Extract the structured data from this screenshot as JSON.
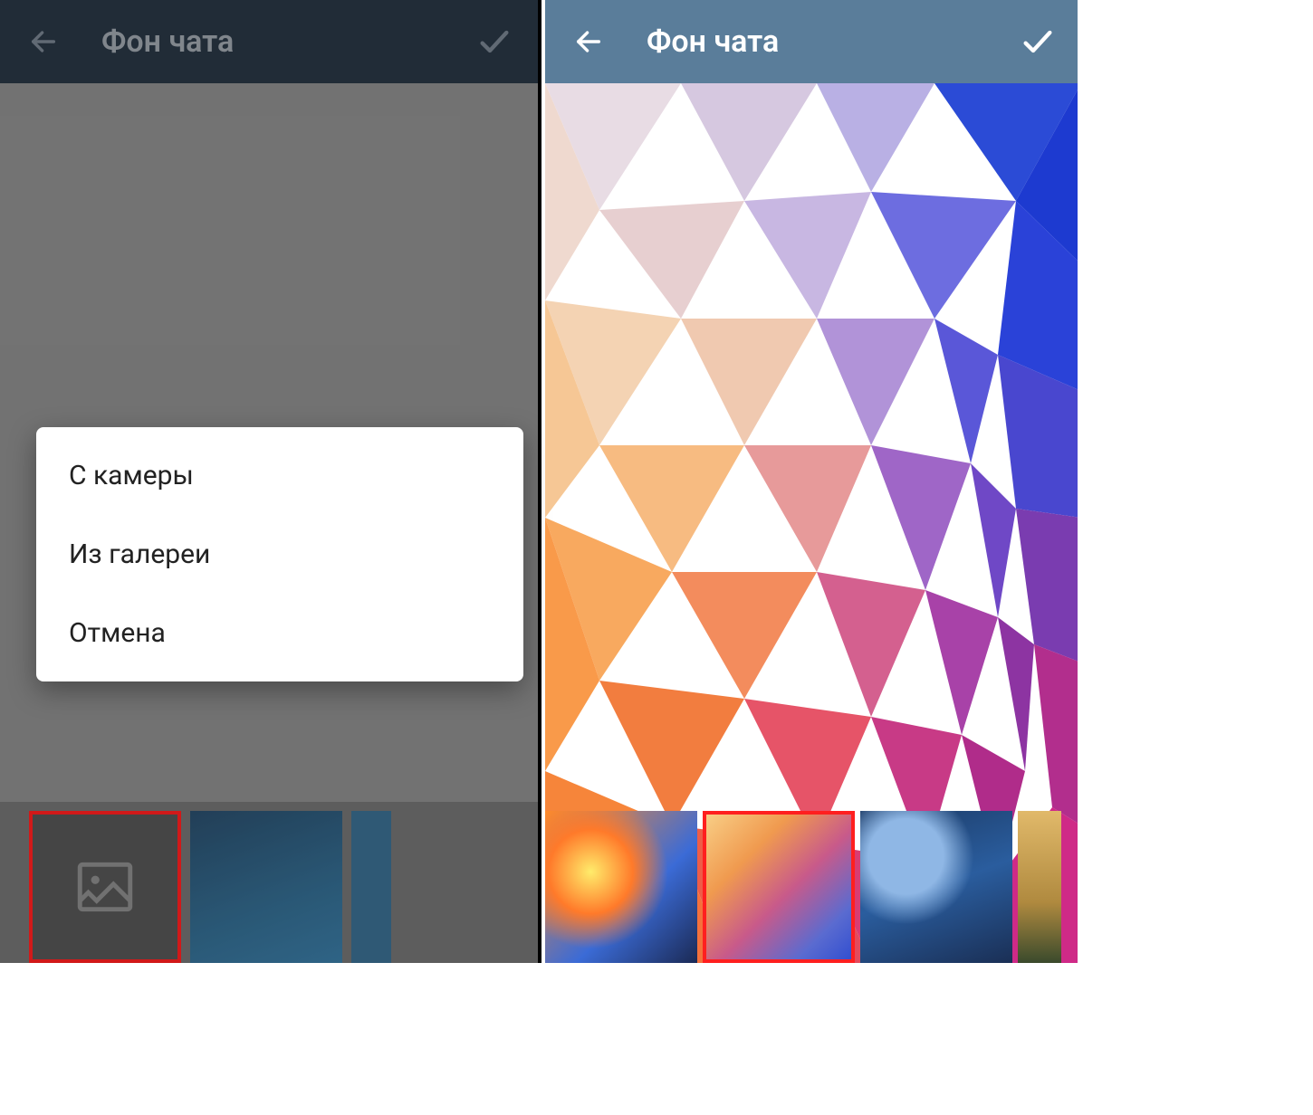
{
  "left": {
    "toolbar": {
      "title": "Фон чата"
    },
    "dialog": {
      "options": [
        {
          "label": "С камеры"
        },
        {
          "label": "Из галереи"
        },
        {
          "label": "Отмена"
        }
      ]
    },
    "thumbs": [
      {
        "name": "upload",
        "selected": true
      },
      {
        "name": "preset-blue-1",
        "selected": false
      },
      {
        "name": "preset-blue-2",
        "selected": false
      }
    ]
  },
  "right": {
    "toolbar": {
      "title": "Фон чата"
    },
    "thumbs": [
      {
        "name": "preset-orange-space",
        "selected": false
      },
      {
        "name": "preset-poly-warm",
        "selected": true
      },
      {
        "name": "preset-nebula-blue",
        "selected": false
      },
      {
        "name": "preset-gold-bokeh",
        "selected": false
      }
    ]
  },
  "icons": {
    "back": "arrow-left",
    "confirm": "check",
    "image": "image-placeholder"
  }
}
